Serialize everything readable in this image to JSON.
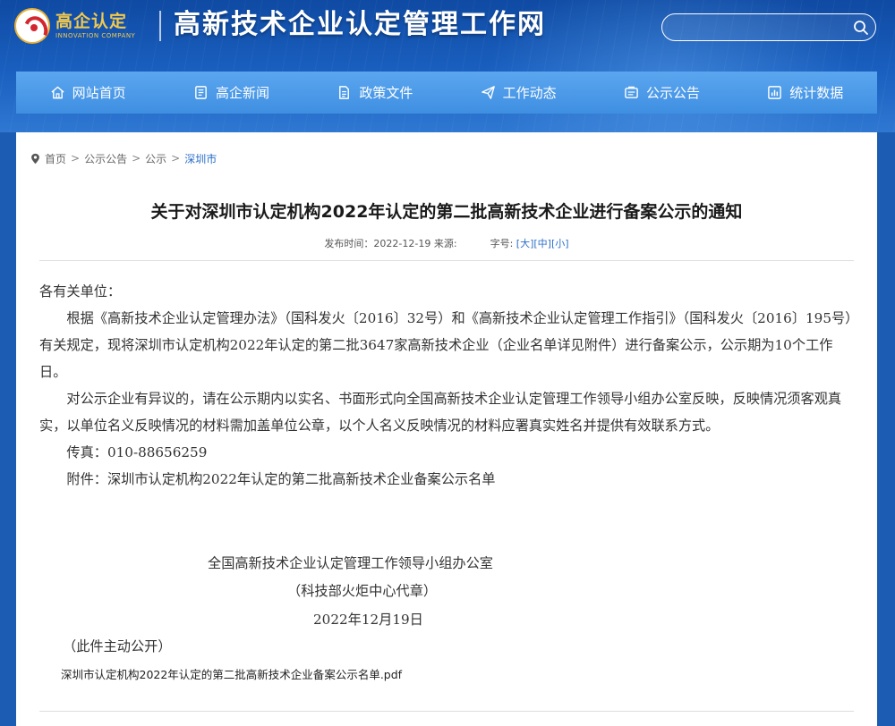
{
  "header": {
    "logo_cn": "高企认定",
    "logo_en": "INNOVATION COMPANY",
    "site_title": "高新技术企业认定管理工作网",
    "search_placeholder": ""
  },
  "nav": {
    "items": [
      {
        "label": "网站首页",
        "icon": "home-icon"
      },
      {
        "label": "高企新闻",
        "icon": "news-icon"
      },
      {
        "label": "政策文件",
        "icon": "document-icon"
      },
      {
        "label": "工作动态",
        "icon": "paper-plane-icon"
      },
      {
        "label": "公示公告",
        "icon": "announcement-icon"
      },
      {
        "label": "统计数据",
        "icon": "chart-icon"
      }
    ]
  },
  "breadcrumb": {
    "items": [
      "首页",
      "公示公告",
      "公示"
    ],
    "current": "深圳市",
    "separator": ">"
  },
  "article": {
    "title": "关于对深圳市认定机构2022年认定的第二批高新技术企业进行备案公示的通知",
    "meta_time_label": "发布时间：",
    "meta_time": "2022-12-19",
    "meta_source_label": "来源:",
    "meta_size_label": "字号:",
    "size_large": "[大]",
    "size_medium": "[中]",
    "size_small": "[小]",
    "salutation": "各有关单位：",
    "para1": "根据《高新技术企业认定管理办法》（国科发火〔2016〕32号）和《高新技术企业认定管理工作指引》（国科发火〔2016〕195号）有关规定，现将深圳市认定机构2022年认定的第二批3647家高新技术企业（企业名单详见附件）进行备案公示，公示期为10个工作日。",
    "para2": "对公示企业有异议的，请在公示期内以实名、书面形式向全国高新技术企业认定管理工作领导小组办公室反映，反映情况须客观真实，以单位名义反映情况的材料需加盖单位公章，以个人名义反映情况的材料应署真实姓名并提供有效联系方式。",
    "fax": "传真：010-88656259",
    "attachment_line": "附件：深圳市认定机构2022年认定的第二批高新技术企业备案公示名单",
    "sign_org": "全国高新技术企业认定管理工作领导小组办公室",
    "sign_seal": "（科技部火炬中心代章）",
    "sign_date": "2022年12月19日",
    "public_note": "（此件主动公开）",
    "attachment_file": "深圳市认定机构2022年认定的第二批高新技术企业备案公示名单.pdf"
  },
  "colors": {
    "header_blue": "#1a60c0",
    "nav_blue": "#4a98e8",
    "link_blue": "#2a6fc8"
  }
}
